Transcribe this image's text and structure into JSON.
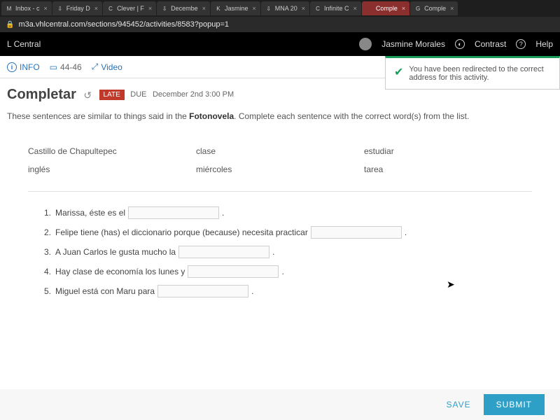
{
  "browser": {
    "url": "m3a.vhlcentral.com/sections/945452/activities/8583?popup=1",
    "tabs": [
      {
        "fav": "M",
        "label": "Inbox - c"
      },
      {
        "fav": "⇩",
        "label": "Friday D"
      },
      {
        "fav": "C",
        "label": "Clever | F"
      },
      {
        "fav": "⇩",
        "label": "Decembe"
      },
      {
        "fav": "K",
        "label": "Jasmine"
      },
      {
        "fav": "⇩",
        "label": "MNA 20"
      },
      {
        "fav": "C",
        "label": "Infinite C"
      },
      {
        "fav": "",
        "label": "Comple",
        "active": true
      },
      {
        "fav": "G",
        "label": "Comple"
      }
    ]
  },
  "site_header": {
    "title": "L Central",
    "username": "Jasmine Morales",
    "contrast": "Contrast",
    "help": "Help"
  },
  "topbar": {
    "info": "INFO",
    "pages": "44-46",
    "video": "Video"
  },
  "toast": "You have been redirected to the correct address for this activity.",
  "activity": {
    "title": "Completar",
    "badge": "LATE",
    "due_label": "DUE",
    "due_value": "December 2nd 3:00 PM",
    "instructions_pre": "These sentences are similar to things said in the ",
    "instructions_bold": "Fotonovela",
    "instructions_post": ". Complete each sentence with the correct word(s) from the list."
  },
  "wordbank": {
    "row1": [
      "Castillo de Chapultepec",
      "clase",
      "estudiar"
    ],
    "row2": [
      "inglés",
      "miércoles",
      "tarea"
    ]
  },
  "questions": [
    {
      "n": "1.",
      "pre": "Marissa, éste es el",
      "post": "."
    },
    {
      "n": "2.",
      "pre": "Felipe tiene (has) el diccionario porque (because) necesita practicar",
      "post": "."
    },
    {
      "n": "3.",
      "pre": "A Juan Carlos le gusta mucho la",
      "post": "."
    },
    {
      "n": "4.",
      "pre": "Hay clase de economía los lunes y",
      "post": "."
    },
    {
      "n": "5.",
      "pre": "Miguel está con Maru para",
      "post": "."
    }
  ],
  "footer": {
    "save": "SAVE",
    "submit": "SUBMIT"
  }
}
